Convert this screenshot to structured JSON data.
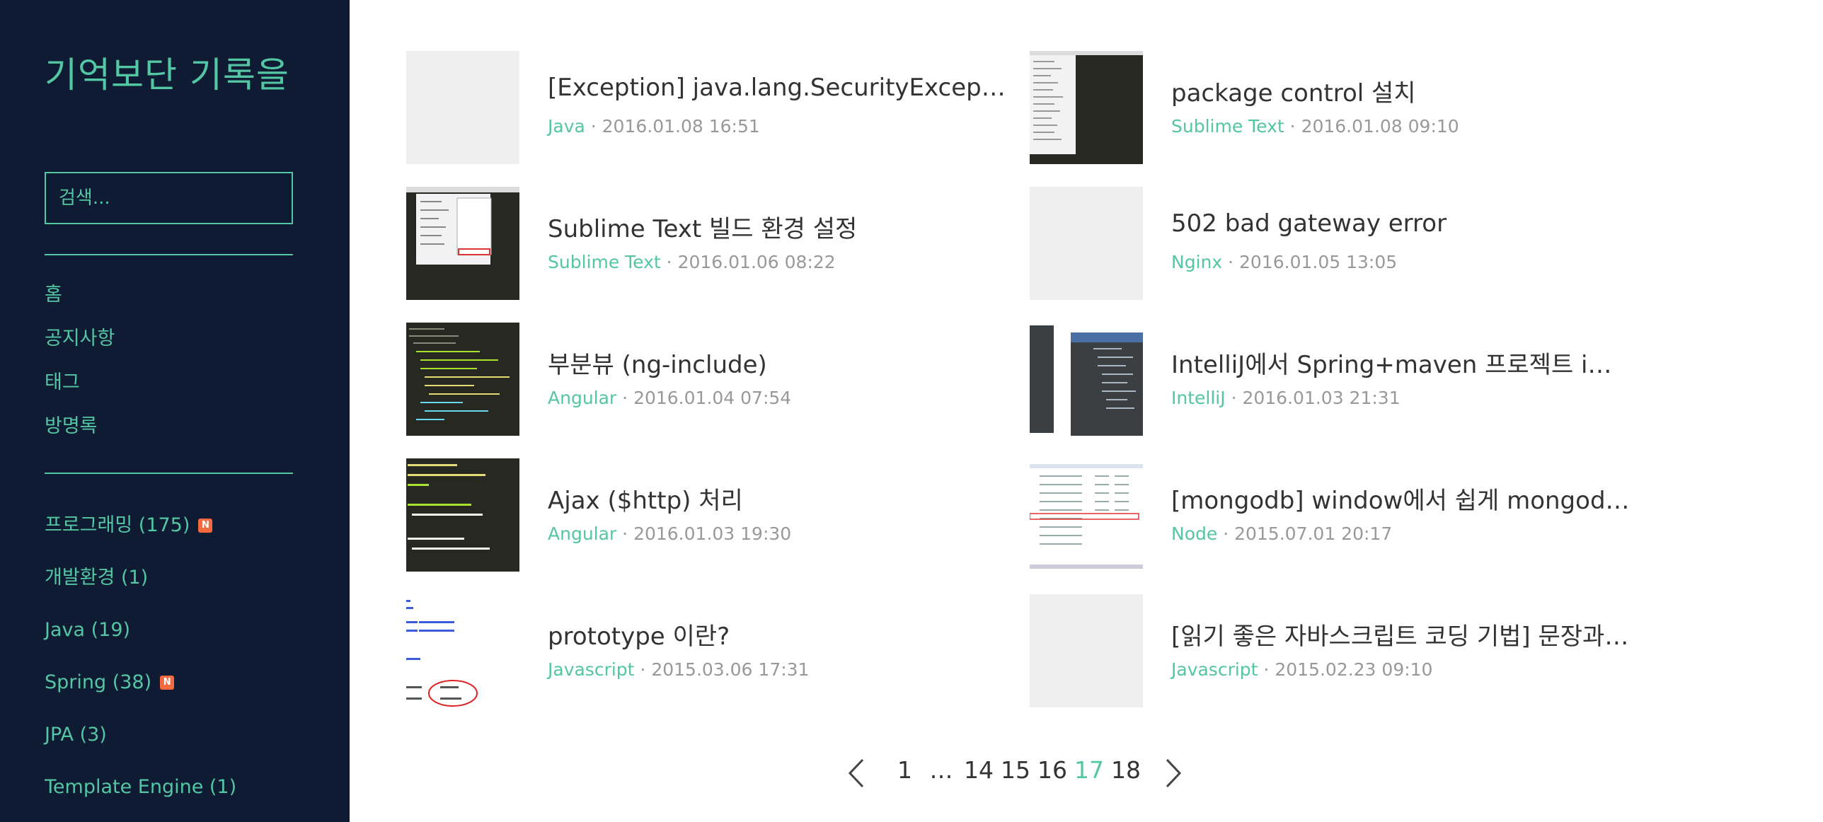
{
  "sidebar": {
    "blog_title": "기억보단 기록을",
    "search_placeholder": "검색...",
    "nav": [
      "홈",
      "공지사항",
      "태그",
      "방명록"
    ],
    "categories": [
      {
        "label": "프로그래밍 (175)",
        "new": true
      },
      {
        "label": "개발환경 (1)",
        "new": false
      },
      {
        "label": "Java (19)",
        "new": false
      },
      {
        "label": "Spring (38)",
        "new": true
      },
      {
        "label": "JPA (3)",
        "new": false
      },
      {
        "label": "Template Engine (1)",
        "new": false
      }
    ],
    "new_badge": "N"
  },
  "posts": [
    {
      "title": "[Exception] java.lang.SecurityException:…",
      "category": "Java",
      "date": "2016.01.08 16:51",
      "thumb": "blank"
    },
    {
      "title": "package control 설치",
      "category": "Sublime Text",
      "date": "2016.01.08 09:10",
      "thumb": "menu"
    },
    {
      "title": "Sublime Text 빌드 환경 설정",
      "category": "Sublime Text",
      "date": "2016.01.06 08:22",
      "thumb": "menu2"
    },
    {
      "title": "502 bad gateway error",
      "category": "Nginx",
      "date": "2016.01.05 13:05",
      "thumb": "blank"
    },
    {
      "title": "부분뷰 (ng-include)",
      "category": "Angular",
      "date": "2016.01.04 07:54",
      "thumb": "code"
    },
    {
      "title": "IntelliJ에서 Spring+maven 프로젝트 impo…",
      "category": "IntelliJ",
      "date": "2016.01.03 21:31",
      "thumb": "ide"
    },
    {
      "title": "Ajax ($http) 처리",
      "category": "Angular",
      "date": "2016.01.03 19:30",
      "thumb": "code2"
    },
    {
      "title": "[mongodb] window에서 쉽게 mongodb r…",
      "category": "Node",
      "date": "2015.07.01 20:17",
      "thumb": "table"
    },
    {
      "title": "prototype 이란?",
      "category": "Javascript",
      "date": "2015.03.06 17:31",
      "thumb": "proto"
    },
    {
      "title": "[읽기 좋은 자바스크립트 코딩 기법] 문장과…",
      "category": "Javascript",
      "date": "2015.02.23 09:10",
      "thumb": "blank"
    }
  ],
  "meta_separator": " · ",
  "pagination": {
    "pages": [
      "1",
      "…",
      "14",
      "15",
      "16",
      "17",
      "18"
    ],
    "current": "17",
    "prev_icon": "chevron-left-icon",
    "next_icon": "chevron-right-icon"
  },
  "colors": {
    "accent": "#53c6a3",
    "sidebar_bg": "#0f1a33",
    "badge": "#f26a3d"
  }
}
